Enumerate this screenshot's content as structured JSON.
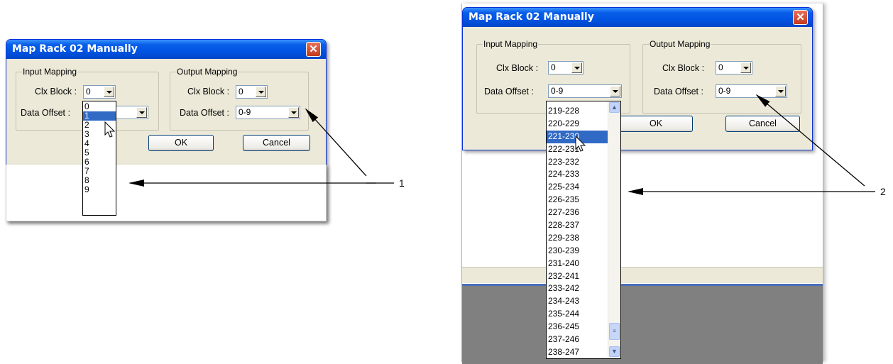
{
  "left": {
    "dialog_title": "Map Rack 02 Manually",
    "close_glyph": "✕",
    "input_group": "Input Mapping",
    "output_group": "Output Mapping",
    "clx_label": "Clx Block :",
    "offset_label": "Data Offset :",
    "input_clx_value": "0",
    "output_clx_value": "0",
    "output_offset_value": "0-9",
    "dropdown_items": [
      "0",
      "1",
      "2",
      "3",
      "4",
      "5",
      "6",
      "7",
      "8",
      "9"
    ],
    "dropdown_selected": "1",
    "ok_label": "OK",
    "cancel_label": "Cancel"
  },
  "right": {
    "dialog_title": "Map Rack 02 Manually",
    "close_glyph": "✕",
    "input_group": "Input Mapping",
    "output_group": "Output Mapping",
    "clx_label": "Clx Block :",
    "offset_label": "Data Offset :",
    "input_clx_value": "0",
    "input_offset_value": "0-9",
    "output_clx_value": "0",
    "output_offset_value": "0-9",
    "dropdown_items": [
      "219-228",
      "220-229",
      "221-230",
      "222-231",
      "223-232",
      "224-233",
      "225-234",
      "226-235",
      "227-236",
      "228-237",
      "229-238",
      "230-239",
      "231-240",
      "232-241",
      "233-242",
      "234-243",
      "235-244",
      "236-245",
      "237-246",
      "238-247"
    ],
    "dropdown_selected": "221-230",
    "ok_label": "OK",
    "cancel_label": "Cancel"
  },
  "callouts": {
    "left": "1",
    "right": "2"
  },
  "colors": {
    "titlebar": "#0054E3",
    "selection": "#316AC5",
    "dialog_face": "#ECE9D8",
    "close": "#C33A1C"
  }
}
